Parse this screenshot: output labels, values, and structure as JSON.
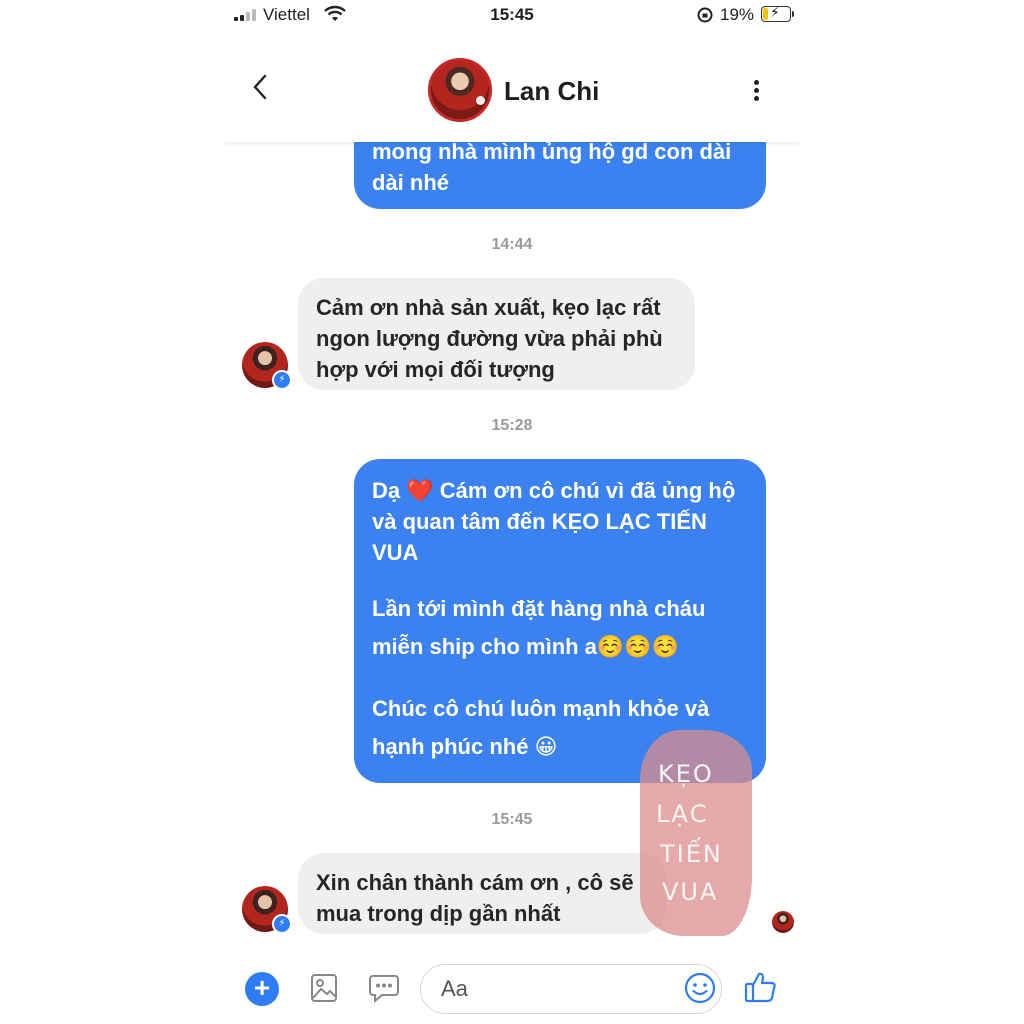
{
  "status_bar": {
    "carrier": "Viettel",
    "time": "15:45",
    "battery": "19%",
    "battery_level": 0.19
  },
  "header": {
    "contact_name": "Lan Chi"
  },
  "messages": {
    "m1": "mong nhà mình ủng hộ gd con dài\ndài nhé",
    "t1": "14:44",
    "m2": "Cảm ơn nhà sản xuất, kẹo lạc rất\nngon lượng đường vừa phải phù\nhợp với mọi đối tượng",
    "t2": "15:28",
    "m3_line1": "Dạ ❤️ Cám ơn cô chú vì đã ủng hộ\nvà quan tâm đến KẸO LẠC TIẾN\nVUA",
    "m3_line2": "Lần tới mình đặt hàng nhà cháu\nmiễn ship cho mình a☺️☺️☺️",
    "m3_line3": "Chúc cô chú luôn mạnh khỏe và\nhạnh phúc nhé 😀",
    "t3": "15:45",
    "m4": "Xin chân thành cám ơn , cô sẽ\nmua trong dịp gần nhất"
  },
  "watermark": {
    "lines": [
      "KẸO",
      "LẠC",
      "TIẾN",
      "VUA"
    ]
  },
  "composer": {
    "placeholder": "Aa"
  },
  "colors": {
    "outgoing_bubble": "#3b82f0",
    "incoming_bubble": "#efefef",
    "accent": "#2e7cf6"
  }
}
